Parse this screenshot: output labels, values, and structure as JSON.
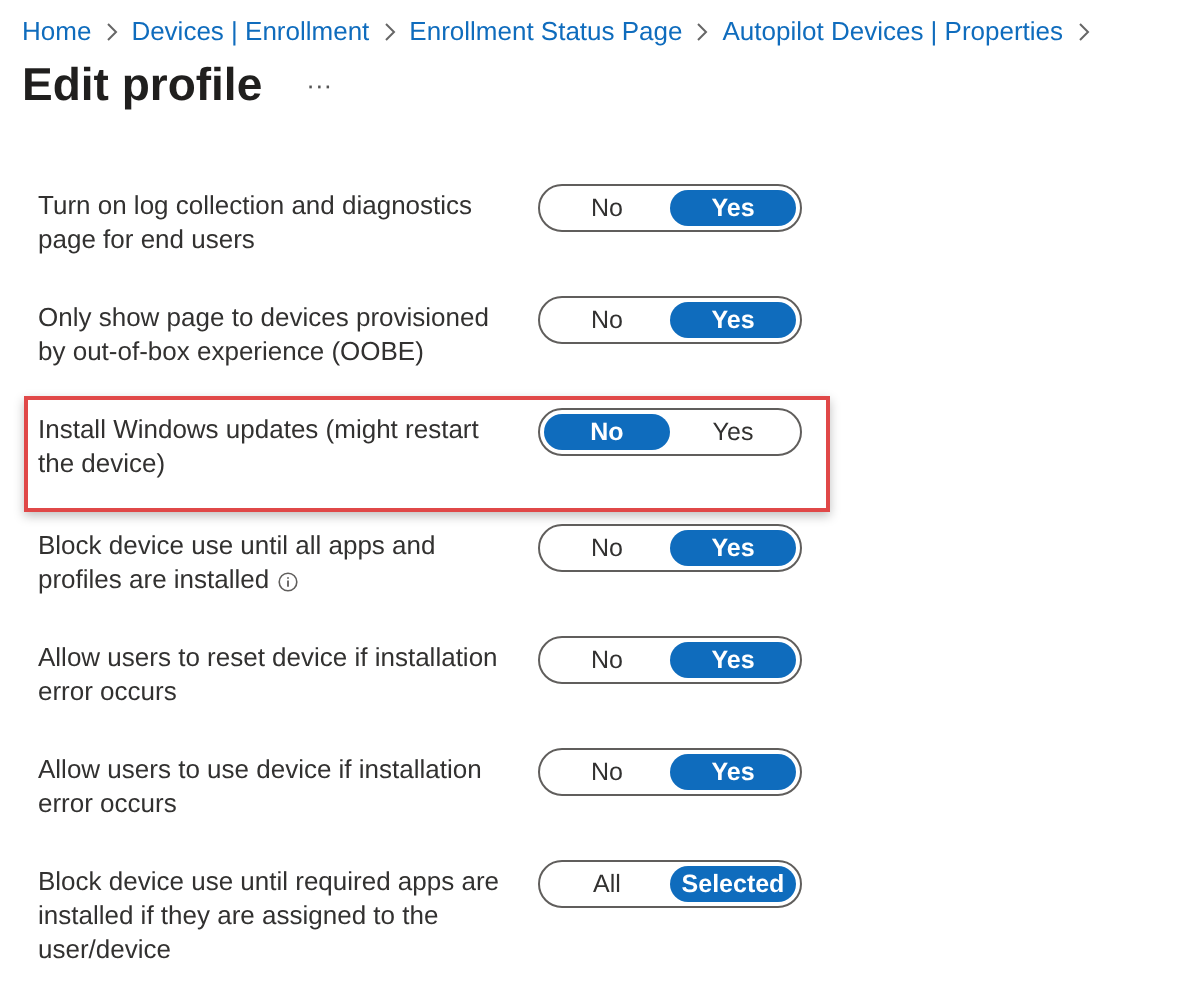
{
  "breadcrumb": [
    {
      "label": "Home"
    },
    {
      "label": "Devices | Enrollment"
    },
    {
      "label": "Enrollment Status Page"
    },
    {
      "label": "Autopilot Devices | Properties"
    }
  ],
  "title": "Edit profile",
  "more": "···",
  "settings": [
    {
      "label": "Turn on log collection and diagnostics page for end users",
      "info": false,
      "highlighted": false,
      "options": [
        {
          "label": "No",
          "selected": false
        },
        {
          "label": "Yes",
          "selected": true
        }
      ]
    },
    {
      "label": "Only show page to devices provisioned by out-of-box experience (OOBE)",
      "info": false,
      "highlighted": false,
      "options": [
        {
          "label": "No",
          "selected": false
        },
        {
          "label": "Yes",
          "selected": true
        }
      ]
    },
    {
      "label": "Install Windows updates (might restart the device)",
      "info": false,
      "highlighted": true,
      "options": [
        {
          "label": "No",
          "selected": true
        },
        {
          "label": "Yes",
          "selected": false
        }
      ]
    },
    {
      "label": "Block device use until all apps and profiles are installed",
      "info": true,
      "highlighted": false,
      "options": [
        {
          "label": "No",
          "selected": false
        },
        {
          "label": "Yes",
          "selected": true
        }
      ]
    },
    {
      "label": "Allow users to reset device if installation error occurs",
      "info": false,
      "highlighted": false,
      "options": [
        {
          "label": "No",
          "selected": false
        },
        {
          "label": "Yes",
          "selected": true
        }
      ]
    },
    {
      "label": "Allow users to use device if installation error occurs",
      "info": false,
      "highlighted": false,
      "options": [
        {
          "label": "No",
          "selected": false
        },
        {
          "label": "Yes",
          "selected": true
        }
      ]
    },
    {
      "label": "Block device use until required apps are installed if they are assigned to the user/device",
      "info": false,
      "highlighted": false,
      "options": [
        {
          "label": "All",
          "selected": false
        },
        {
          "label": "Selected",
          "selected": true
        }
      ]
    }
  ]
}
